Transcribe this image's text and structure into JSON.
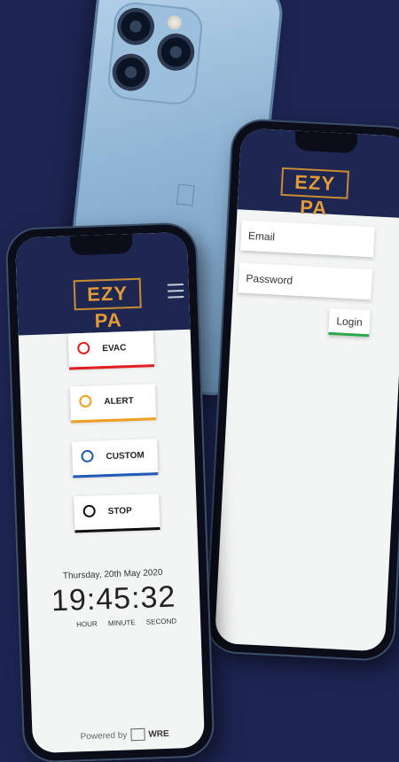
{
  "login_screen": {
    "logo_text": "EZY PA",
    "email_placeholder": "Email",
    "password_placeholder": "Password",
    "login_label": "Login"
  },
  "main_screen": {
    "logo_text": "EZY PA",
    "buttons": [
      {
        "label": "EVAC",
        "color": "#e02020"
      },
      {
        "label": "ALERT",
        "color": "#f0a020"
      },
      {
        "label": "CUSTOM",
        "color": "#1f5ab8"
      },
      {
        "label": "STOP",
        "color": "#111111"
      }
    ],
    "date": "Thursday, 20th May 2020",
    "time": "19:45:32",
    "time_labels": {
      "hour": "HOUR",
      "minute": "MINUTE",
      "second": "SECOND"
    },
    "powered_by": "Powered by",
    "brand": "WRE"
  },
  "colors": {
    "background": "#1d2552",
    "header": "#1e2652",
    "logo_accent": "#e39a38",
    "login_underline": "#2ca84a"
  }
}
